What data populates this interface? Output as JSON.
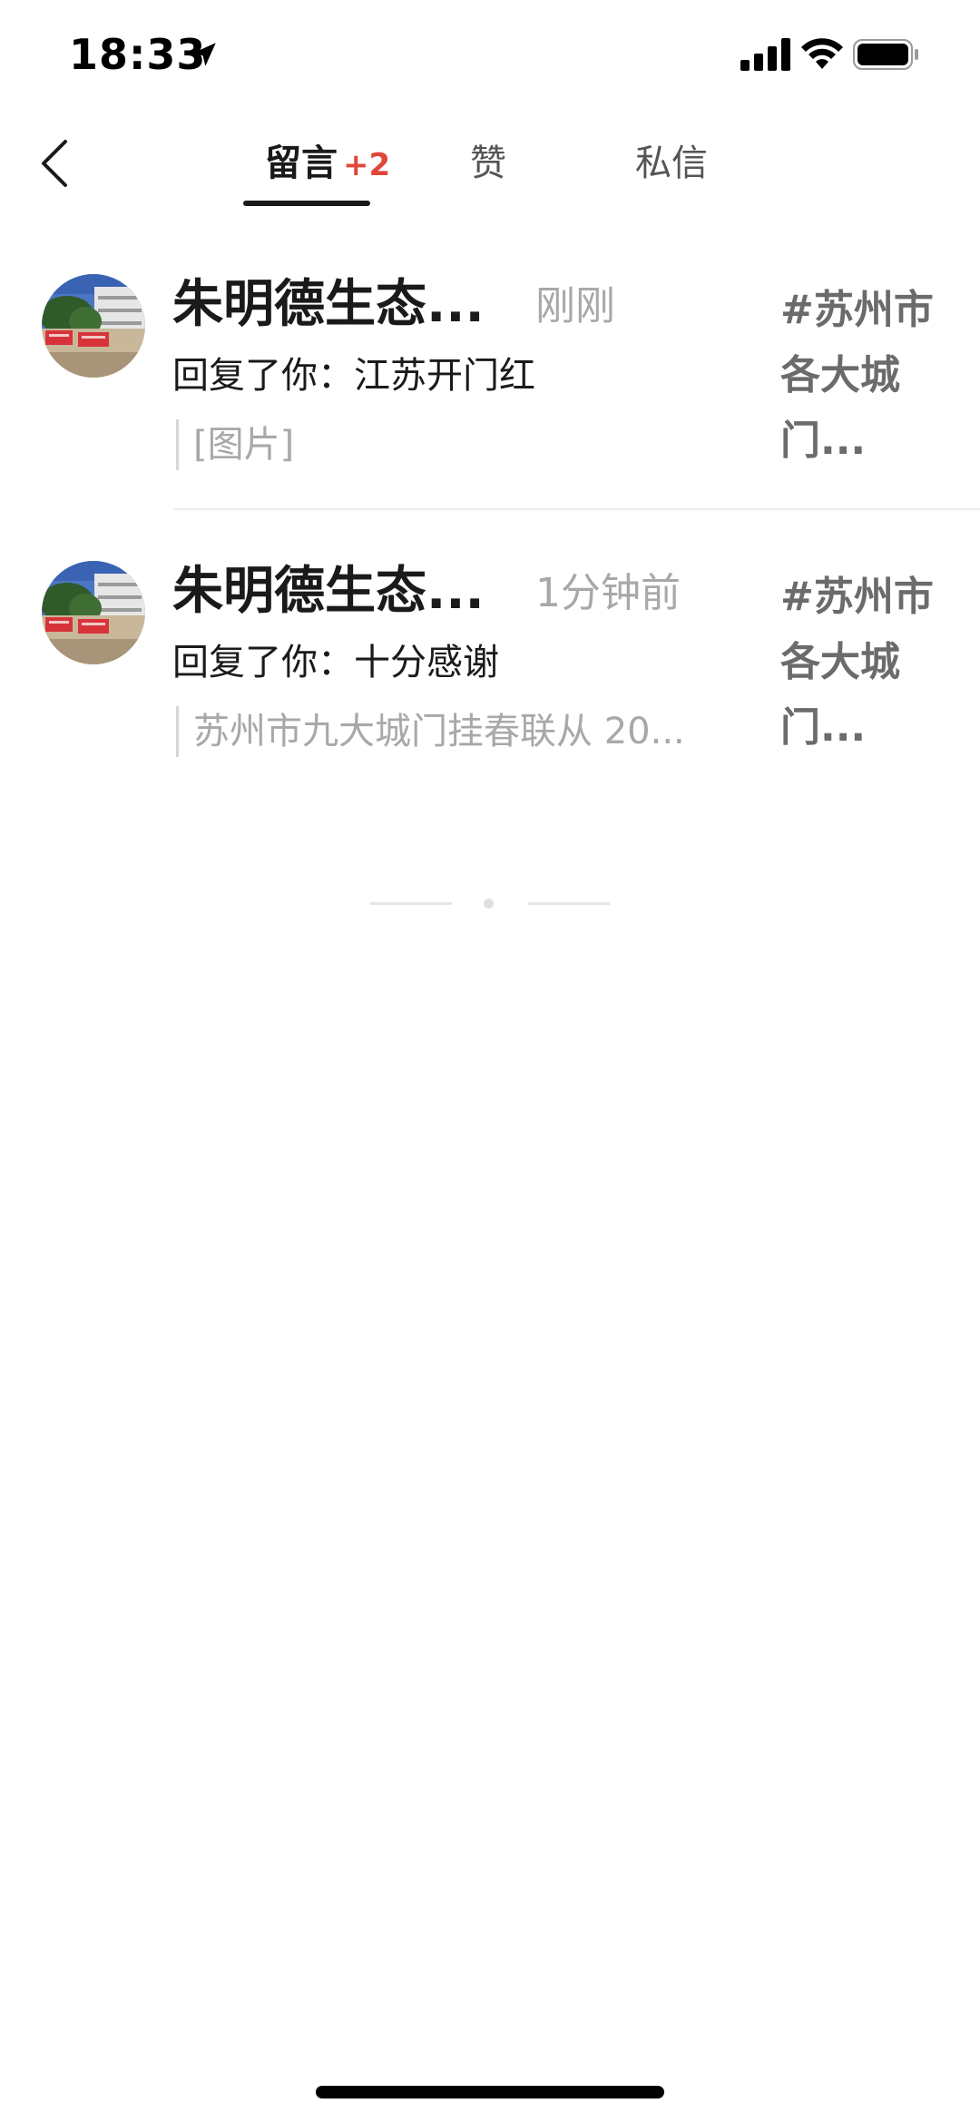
{
  "status_bar": {
    "time": "18:33",
    "icons": [
      "location-arrow-icon",
      "signal-icon",
      "wifi-icon",
      "battery-icon"
    ]
  },
  "header": {
    "back_icon": "chevron-left-icon",
    "tabs": [
      {
        "label": "留言",
        "badge": "+2",
        "active": true
      },
      {
        "label": "赞",
        "active": false
      },
      {
        "label": "私信",
        "active": false
      }
    ]
  },
  "notifications": [
    {
      "name": "朱明德生态...",
      "time": "刚刚",
      "text": "回复了你：江苏开门红",
      "quote": "[图片]",
      "topic": "#苏州市各大城门..."
    },
    {
      "name": "朱明德生态...",
      "time": "1分钟前",
      "text": "回复了你：十分感谢",
      "quote": "苏州市九大城门挂春联从 20...",
      "topic": "#苏州市各大城门..."
    }
  ],
  "colors": {
    "badge": "#e0463a",
    "primary_text": "#1a1a1a",
    "secondary_text": "#a8a8a8",
    "topic_text": "#6b6b6b"
  }
}
